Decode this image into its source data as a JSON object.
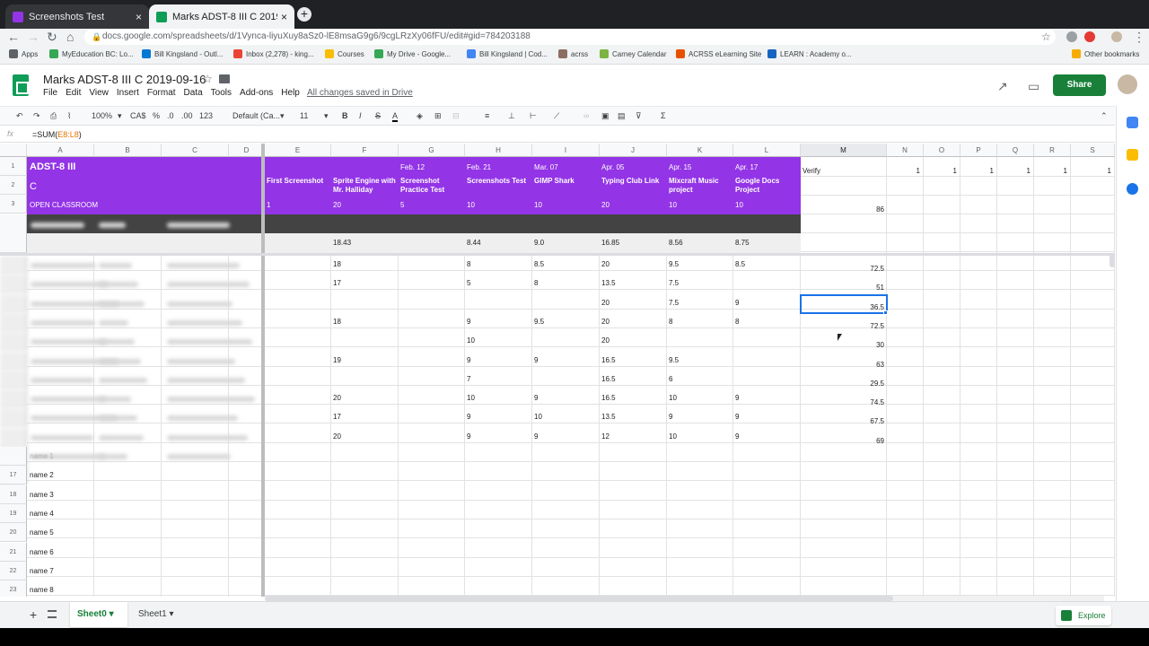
{
  "browser": {
    "tabs": [
      {
        "title": "Screenshots Test",
        "active": false,
        "color": "#9334e6"
      },
      {
        "title": "Marks ADST-8 III C 2019-09-16",
        "active": true,
        "color": "#0f9d58"
      }
    ],
    "close_glyph": "×",
    "newtab_glyph": "+",
    "url": "docs.google.com/spreadsheets/d/1Vynca-liyuXuy8aSz0-lE8msaG9g6/9cgLRzXy06fFU/edit#gid=784203188",
    "bookmarks": [
      {
        "label": "Apps",
        "color": "#5f6368"
      },
      {
        "label": "MyEducation BC: Lo...",
        "color": "#34a853"
      },
      {
        "label": "Bill Kingsland - Outl...",
        "color": "#0078d4"
      },
      {
        "label": "Inbox (2,278) - king...",
        "color": "#ea4335"
      },
      {
        "label": "Courses",
        "color": "#fbbc04"
      },
      {
        "label": "My Drive - Google...",
        "color": "#34a853"
      },
      {
        "label": "Bill Kingsland | Cod...",
        "color": "#4285f4"
      },
      {
        "label": "acrss",
        "color": "#8d6e63"
      },
      {
        "label": "Carney Calendar",
        "color": "#7cb342"
      },
      {
        "label": "ACRSS eLearning Site",
        "color": "#e65100"
      },
      {
        "label": "LEARN : Academy o...",
        "color": "#1565c0"
      }
    ],
    "other_bookmarks": "Other bookmarks"
  },
  "doc": {
    "title": "Marks ADST-8 III C 2019-09-16",
    "menus": [
      "File",
      "Edit",
      "View",
      "Insert",
      "Format",
      "Data",
      "Tools",
      "Add-ons",
      "Help"
    ],
    "saved_status": "All changes saved in Drive",
    "share_label": "Share",
    "accent": "#188038"
  },
  "format_toolbar": {
    "zoom": "100%",
    "currency": "CA$",
    "percent": "%",
    "decimal_less": ".0",
    "decimal_more": ".00",
    "number_format": "123",
    "font": "Default (Ca...",
    "font_size": "11"
  },
  "formula_bar": {
    "fx": "fx",
    "prefix": "=SUM(",
    "range": "E8:L8",
    "suffix": ")"
  },
  "grid": {
    "columns": [
      "A",
      "B",
      "C",
      "D",
      "E",
      "F",
      "G",
      "H",
      "I",
      "J",
      "K",
      "L",
      "M",
      "N",
      "O",
      "P",
      "Q",
      "R",
      "S"
    ],
    "row_numbers": [
      "1",
      "2",
      "3",
      "17",
      "18",
      "19",
      "20",
      "21",
      "22",
      "23"
    ],
    "header_block": {
      "title": "ADST-8 III",
      "section": "C",
      "subtitle": "OPEN CLASSROOM",
      "dates": [
        "",
        "",
        "Feb. 12",
        "Feb. 21",
        "Mar. 07",
        "Apr. 05",
        "Apr. 15",
        "Apr. 17"
      ],
      "assignments": [
        "First Screenshot",
        "Sprite Engine with Mr. Halliday",
        "Screenshot Practice Test",
        "Screenshots Test",
        "GIMP Shark",
        "Typing Club Link",
        "Mixcraft Music project",
        "Google Docs Project"
      ],
      "max_points": [
        "1",
        "20",
        "5",
        "10",
        "10",
        "20",
        "10",
        "10"
      ],
      "purple": "#9334e6"
    },
    "verify_label": "Verify",
    "verify_ones": [
      "1",
      "1",
      "1",
      "1",
      "1",
      "1"
    ],
    "total_max": "86",
    "averages": [
      "",
      "18.43",
      "",
      "8.44",
      "9.0",
      "16.85",
      "8.56",
      "8.75"
    ],
    "student_rows": [
      {
        "cells": [
          "",
          "18",
          "",
          "8",
          "8.5",
          "20",
          "9.5",
          "8.5"
        ],
        "total": "72.5"
      },
      {
        "cells": [
          "",
          "17",
          "",
          "5",
          "8",
          "13.5",
          "7.5",
          ""
        ],
        "total": "51"
      },
      {
        "cells": [
          "",
          "",
          "",
          "",
          "",
          "20",
          "7.5",
          "9"
        ],
        "total": "36.5"
      },
      {
        "cells": [
          "",
          "18",
          "",
          "9",
          "9.5",
          "20",
          "8",
          "8"
        ],
        "total": "72.5"
      },
      {
        "cells": [
          "",
          "",
          "",
          "10",
          "",
          "20",
          "",
          ""
        ],
        "total": "30"
      },
      {
        "cells": [
          "",
          "19",
          "",
          "9",
          "9",
          "16.5",
          "9.5",
          ""
        ],
        "total": "63"
      },
      {
        "cells": [
          "",
          "",
          "",
          "7",
          "",
          "16.5",
          "6",
          ""
        ],
        "total": "29.5"
      },
      {
        "cells": [
          "",
          "20",
          "",
          "10",
          "9",
          "16.5",
          "10",
          "9"
        ],
        "total": "74.5"
      },
      {
        "cells": [
          "",
          "17",
          "",
          "9",
          "10",
          "13.5",
          "9",
          "9"
        ],
        "total": "67.5"
      },
      {
        "cells": [
          "",
          "20",
          "",
          "9",
          "9",
          "12",
          "10",
          "9"
        ],
        "total": "69"
      }
    ],
    "names": [
      "name 1",
      "name 2",
      "name 3",
      "name 4",
      "name 5",
      "name 6",
      "name 7",
      "name 8"
    ]
  },
  "sheet_tabs": [
    {
      "label": "Sheet0",
      "active": true
    },
    {
      "label": "Sheet1",
      "active": false
    }
  ],
  "explore_label": "Explore"
}
